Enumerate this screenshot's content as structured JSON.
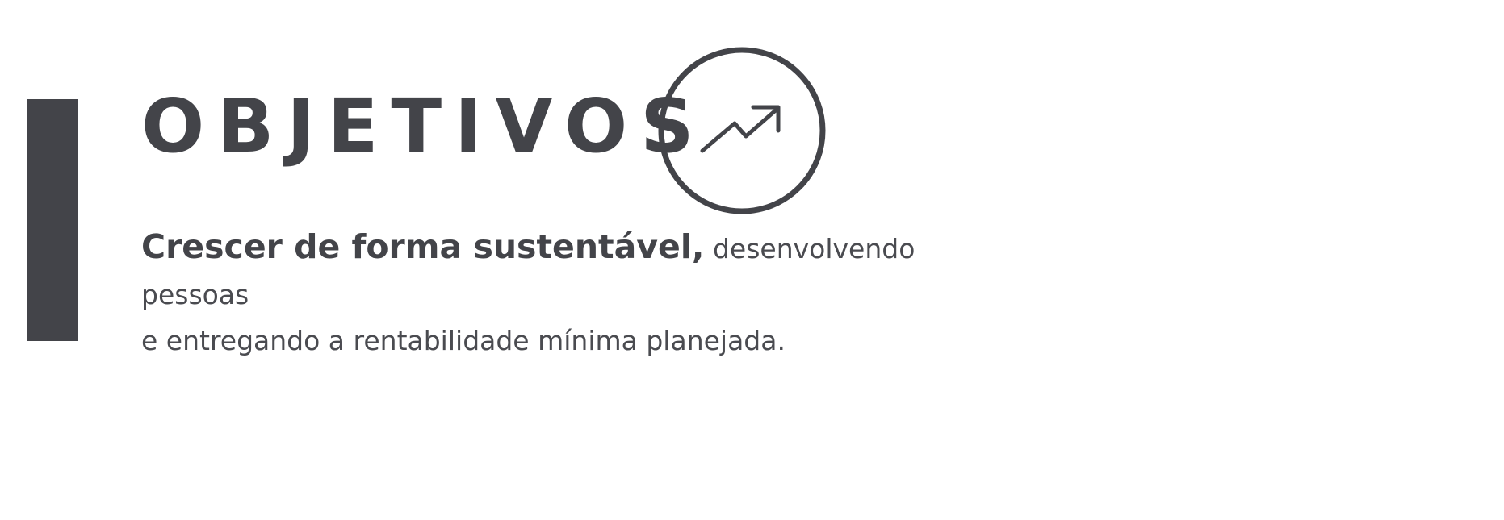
{
  "title": "OBJETIVOS",
  "icon": "trending-up-icon",
  "description": {
    "lead": "Crescer de forma sustentável,",
    "line1_rest": " desenvolvendo pessoas",
    "line2": "e entregando a rentabilidade mínima planejada."
  },
  "colors": {
    "primary": "#434449",
    "text": "#4a4b50",
    "background": "#ffffff"
  }
}
